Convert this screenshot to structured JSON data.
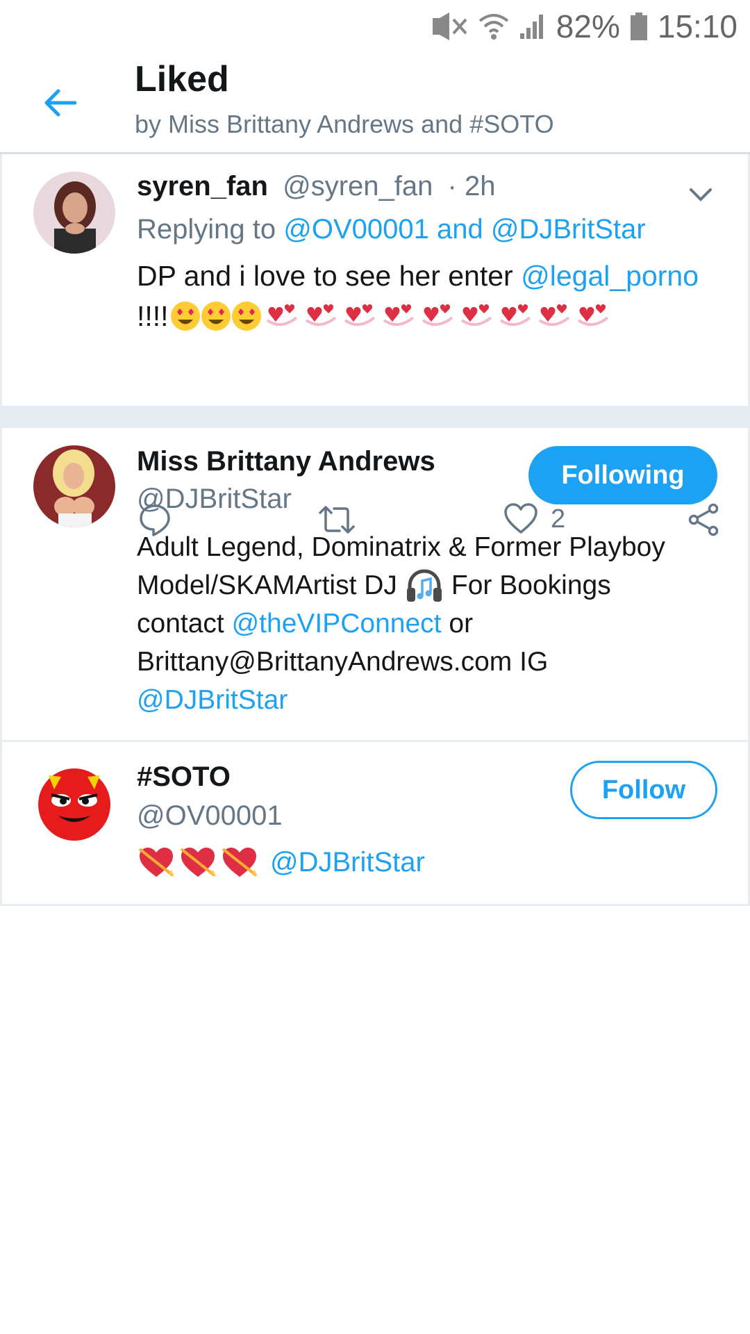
{
  "status_bar": {
    "battery": "82%",
    "time": "15:10"
  },
  "header": {
    "title": "Liked",
    "subtitle": "by Miss Brittany Andrews and #SOTO"
  },
  "tweet": {
    "name": "syren_fan",
    "handle": "@syren_fan",
    "time": "· 2h",
    "replying_prefix": "Replying to",
    "replying_to": "@OV00001 and @DJBritStar",
    "text_start": "DP and i love to see her enter",
    "text_mention": "@legal_porno",
    "text_excl": "!!!!",
    "likes": "2"
  },
  "users": [
    {
      "name": "Miss Brittany Andrews",
      "handle": "@DJBritStar",
      "button": "Following",
      "bio_line1": "Adult Legend, Dominatrix & Former Playboy",
      "bio_line2a": "Model/SKAMArtist DJ",
      "bio_line2b": "For Bookings",
      "bio_line3a": "contact",
      "bio_line3_mention": "@theVIPConnect",
      "bio_line3b": "or",
      "bio_line4": "Brittany@BrittanyAndrews.com IG",
      "bio_line5_mention": "@DJBritStar"
    },
    {
      "name": "#SOTO",
      "handle": "@OV00001",
      "button": "Follow",
      "bio_mention": "@DJBritStar"
    }
  ],
  "colors": {
    "accent": "#1da1f2",
    "muted": "#657786",
    "border": "#e6ecf0"
  }
}
